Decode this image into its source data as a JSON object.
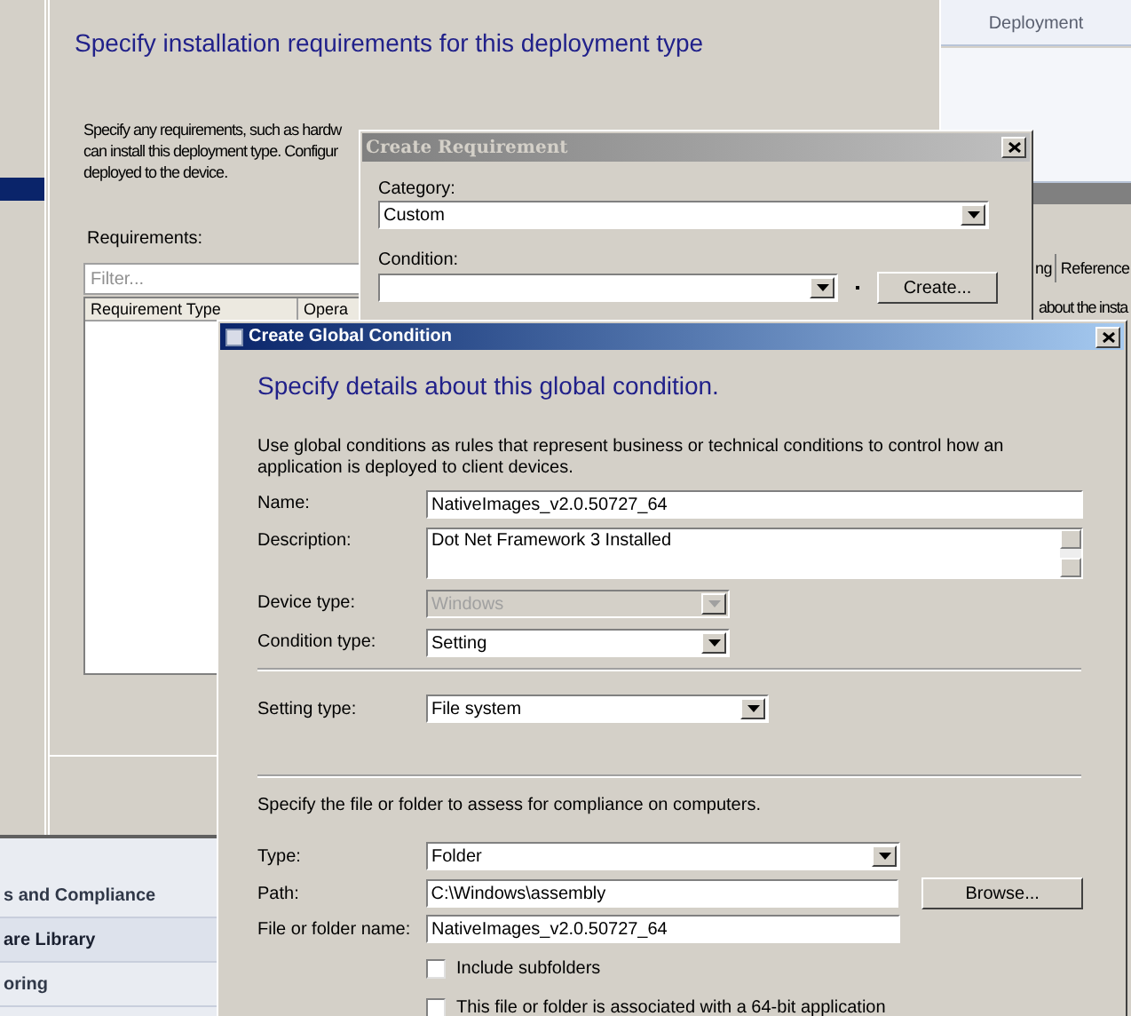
{
  "console": {
    "ribbon_label": "Deployment",
    "tabs": [
      {
        "label": "ng"
      },
      {
        "label": "Reference"
      }
    ],
    "detail_text": "about the insta",
    "nav_items": [
      {
        "label": "s and Compliance",
        "selected": false
      },
      {
        "label": "are Library",
        "selected": true
      },
      {
        "label": "oring",
        "selected": false
      }
    ]
  },
  "wizard": {
    "heading": "Specify installation requirements for this deployment type",
    "description_lines": [
      "Specify any requirements, such as hardw",
      "can install this deployment type. Configur",
      "deployed to the device."
    ],
    "requirements_label": "Requirements:",
    "filter_placeholder": "Filter...",
    "columns": [
      "Requirement Type",
      "Opera"
    ]
  },
  "create_requirement": {
    "title": "Create Requirement",
    "category_label": "Category:",
    "category_value": "Custom",
    "condition_label": "Condition:",
    "create_button": "Create..."
  },
  "global_condition": {
    "title": "Create Global Condition",
    "heading": "Specify details about this global condition.",
    "description": "Use global conditions as rules that represent business or technical conditions to control how an application is deployed to client devices.",
    "fields": [
      {
        "label": "Name:",
        "kind": "text",
        "value": "NativeImages_v2.0.50727_64",
        "disabled": false
      },
      {
        "label": "Description:",
        "kind": "textarea",
        "value": "Dot Net Framework 3 Installed",
        "disabled": false
      },
      {
        "label": "Device type:",
        "kind": "select",
        "value": "Windows",
        "disabled": true
      },
      {
        "label": "Condition type:",
        "kind": "select",
        "value": "Setting",
        "disabled": false
      }
    ],
    "setting_type": {
      "label": "Setting type:",
      "value": "File system"
    },
    "file_section": {
      "instruction": "Specify the file or folder to assess for compliance on computers.",
      "type": {
        "label": "Type:",
        "value": "Folder"
      },
      "path": {
        "label": "Path:",
        "value": "C:\\Windows\\assembly"
      },
      "browse_button": "Browse...",
      "file_name": {
        "label": "File or folder name:",
        "value": "NativeImages_v2.0.50727_64"
      },
      "options": [
        {
          "label": "Include subfolders",
          "checked": false
        },
        {
          "label": "This file or folder is associated with a 64-bit application",
          "checked": false
        }
      ]
    }
  }
}
